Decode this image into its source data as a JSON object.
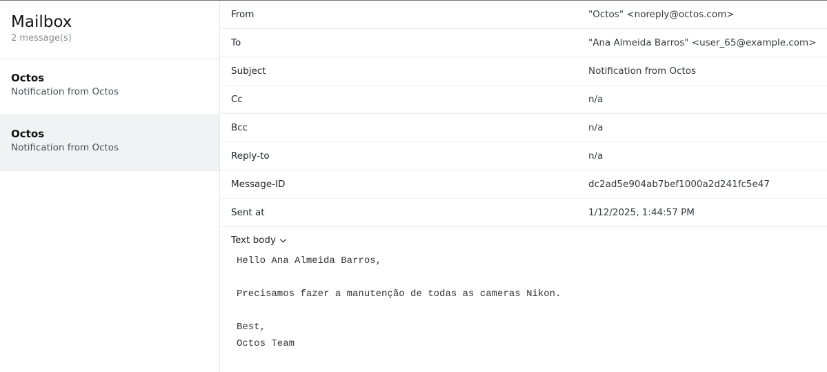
{
  "sidebar": {
    "title": "Mailbox",
    "count": "2 message(s)",
    "items": [
      {
        "from": "Octos",
        "subject": "Notification from Octos"
      },
      {
        "from": "Octos",
        "subject": "Notification from Octos"
      }
    ]
  },
  "headers": {
    "from_label": "From",
    "from_value": "\"Octos\" <noreply@octos.com>",
    "to_label": "To",
    "to_value": "\"Ana Almeida Barros\" <user_65@example.com>",
    "subject_label": "Subject",
    "subject_value": "Notification from Octos",
    "cc_label": "Cc",
    "cc_value": "n/a",
    "bcc_label": "Bcc",
    "bcc_value": "n/a",
    "replyto_label": "Reply-to",
    "replyto_value": "n/a",
    "messageid_label": "Message-ID",
    "messageid_value": "dc2ad5e904ab7bef1000a2d241fc5e47",
    "sentat_label": "Sent at",
    "sentat_value": "1/12/2025, 1:44:57 PM"
  },
  "body": {
    "toggle_label": "Text body",
    "toggle_icon": "chevron-down-icon",
    "text": "Hello Ana Almeida Barros,\n\nPrecisamos fazer a manutenção de todas as cameras Nikon.\n\nBest,\nOctos Team"
  }
}
